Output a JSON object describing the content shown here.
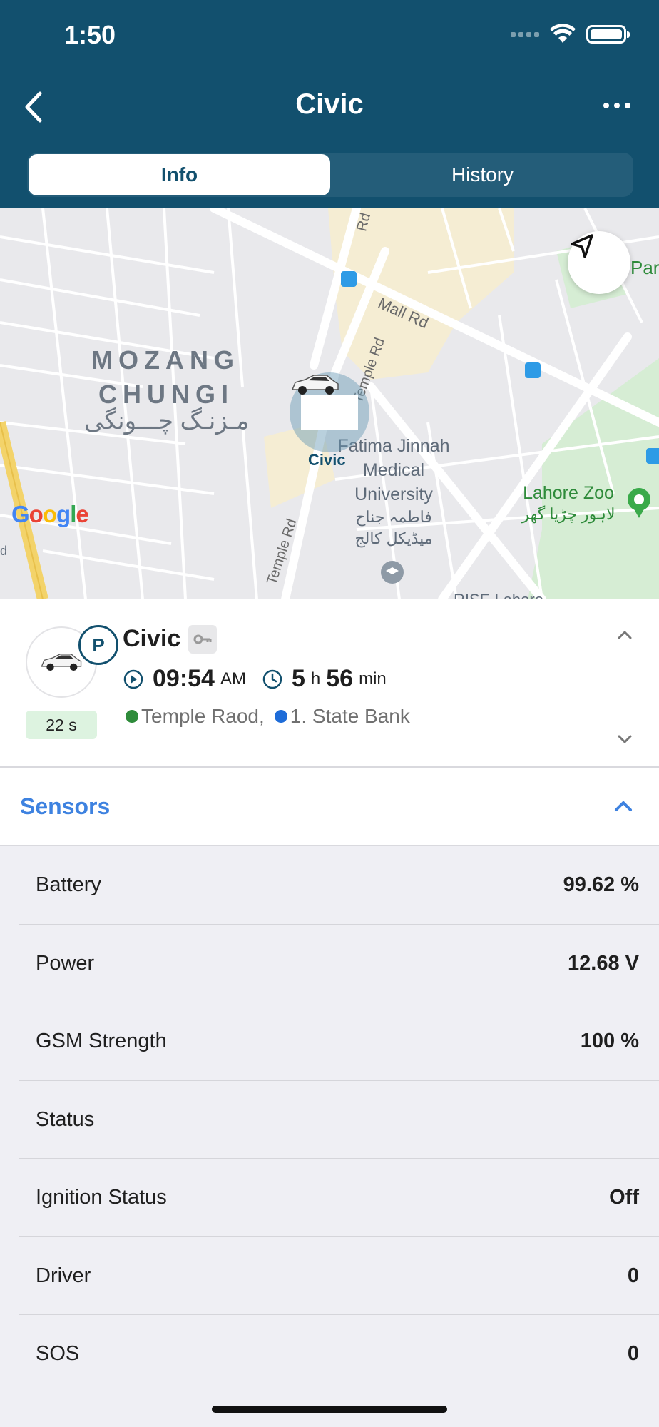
{
  "status_bar": {
    "time": "1:50"
  },
  "nav": {
    "title": "Civic",
    "back_icon": "chevron-left-icon",
    "more_icon": "ellipsis-icon"
  },
  "tabs": [
    {
      "label": "Info",
      "active": true
    },
    {
      "label": "History",
      "active": false
    }
  ],
  "map": {
    "district": [
      "MOZANG",
      "CHUNGI"
    ],
    "district_urdu": "مـزنـگ چـــونگی",
    "roads": [
      "Mall Rd",
      "Temple Rd",
      "Temple Rd",
      "Rd"
    ],
    "poi": [
      "Fatima Jinnah",
      "Medical",
      "University",
      "فاطمہ جناح",
      "میڈیکل کالج"
    ],
    "zoo": [
      "Lahore Zoo",
      "لاہور چڑیا گھر"
    ],
    "edge_labels": [
      "Par",
      "d",
      "RISE Lahore"
    ],
    "marker_label": "Civic",
    "logo": [
      "G",
      "o",
      "o",
      "g",
      "l",
      "e"
    ],
    "logo_colors": [
      "#4285F4",
      "#EA4335",
      "#FBBC05",
      "#4285F4",
      "#34A853",
      "#EA4335"
    ]
  },
  "vehicle": {
    "name": "Civic",
    "status_letter": "P",
    "last_update": "22 s",
    "time": "09:54",
    "time_suffix": "AM",
    "duration_hours": "5",
    "duration_hours_unit": "h",
    "duration_minutes": "56",
    "duration_minutes_unit": "min",
    "location_1": "Temple Raod,",
    "location_2": "1. State Bank",
    "location_1_color": "#2E8B3A",
    "location_2_color": "#1E6CD8"
  },
  "sensors": {
    "title": "Sensors",
    "items": [
      {
        "name": "Battery",
        "value": "99.62 %"
      },
      {
        "name": "Power",
        "value": "12.68 V"
      },
      {
        "name": "GSM Strength",
        "value": "100 %"
      },
      {
        "name": "Status",
        "value": ""
      },
      {
        "name": "Ignition Status",
        "value": "Off"
      },
      {
        "name": "Driver",
        "value": "0"
      },
      {
        "name": "SOS",
        "value": "0"
      }
    ]
  },
  "colors": {
    "header": "#12506E",
    "accent": "#3E82E0"
  }
}
